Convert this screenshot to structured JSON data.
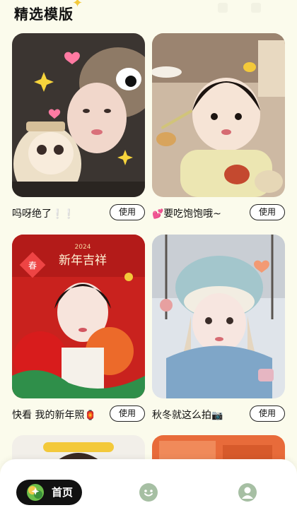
{
  "header": {
    "title": "精选模版"
  },
  "cards": [
    {
      "caption": "吗呀绝了",
      "emoji": "❕❕",
      "button": "使用"
    },
    {
      "caption": "要吃饱饱哦~",
      "emoji": "💕",
      "button": "使用"
    },
    {
      "caption": "快看 我的新年照",
      "emoji": "🏮",
      "button": "使用"
    },
    {
      "caption": "秋冬就这么拍",
      "emoji": "📷",
      "button": "使用"
    }
  ],
  "thumb_text": {
    "year": "2024",
    "greeting": "新年吉祥",
    "fu": "春"
  },
  "nav": {
    "home_label": "首页",
    "items": [
      "home-icon",
      "smile-icon",
      "profile-icon"
    ]
  },
  "colors": {
    "background": "#fbfbec",
    "nav_active": "#111111",
    "nav_inactive": "#a6bfa3",
    "accent_yellow": "#f3c93a"
  }
}
